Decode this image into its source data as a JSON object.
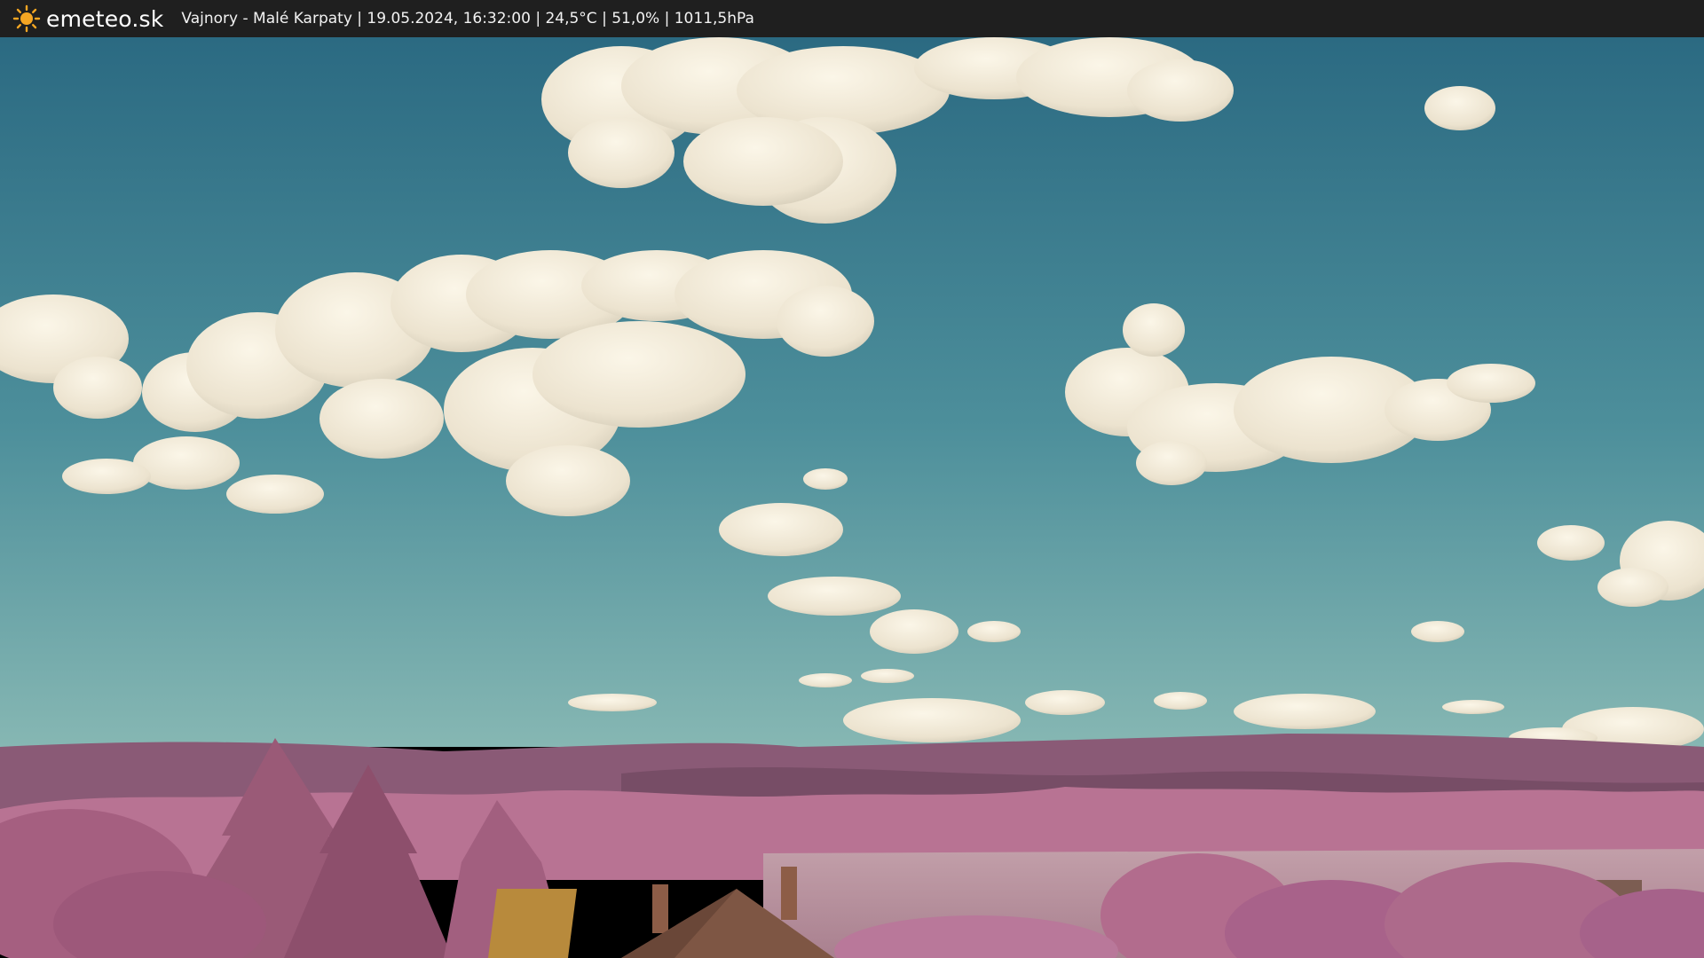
{
  "header": {
    "brand": "emeteo.sk",
    "caption": "Vajnory - Malé Karpaty | 19.05.2024, 16:32:00 | 24,5°C | 51,0% | 1011,5hPa",
    "brand_icon": "sun-icon"
  },
  "colors": {
    "bar": "#1f1f1f",
    "sun": "#f5a623",
    "sky_top": "#2f7186",
    "sky_bottom": "#6aa6a8",
    "cloud": "#f3eddc",
    "hills": "#8a5a76",
    "trees": "#a8637f",
    "field": "#b8919d",
    "roof": "#8a5a46"
  }
}
